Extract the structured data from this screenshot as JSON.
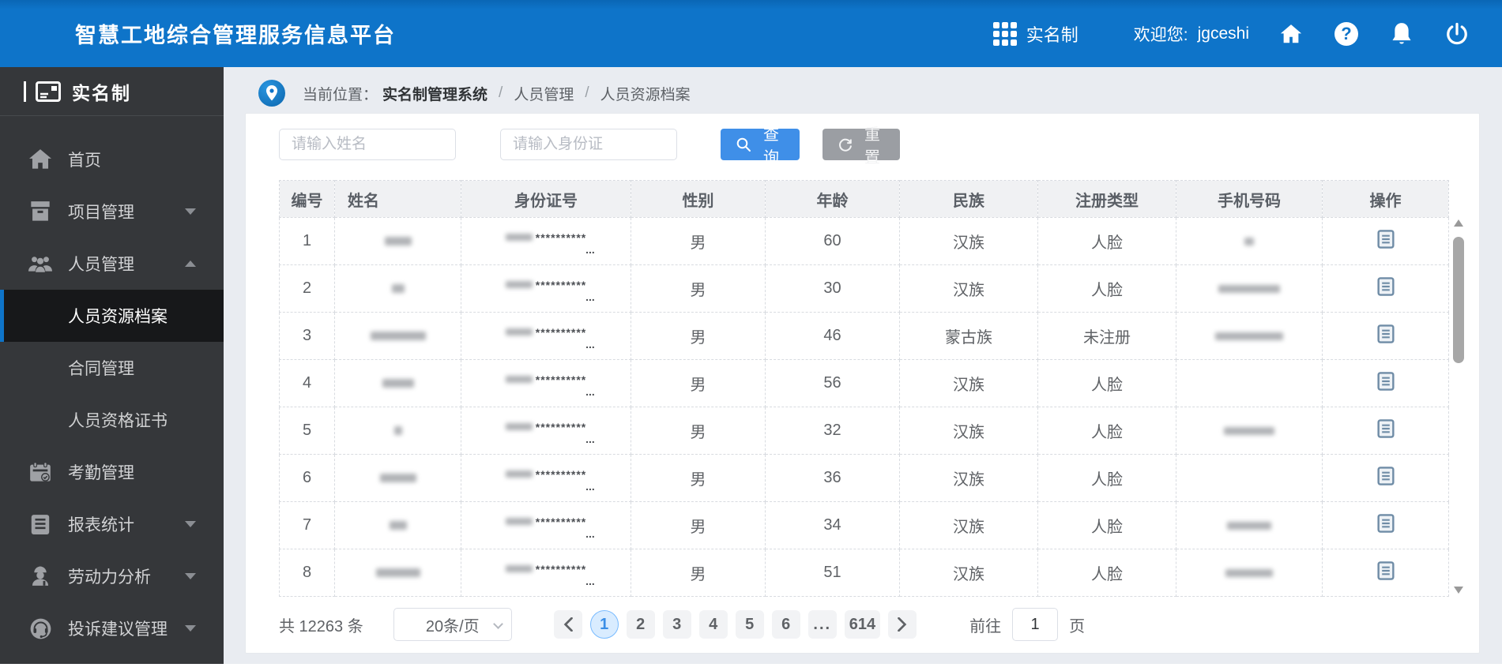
{
  "app": {
    "title": "智慧工地综合管理服务信息平台"
  },
  "topbar": {
    "module_label": "实名制",
    "welcome_label": "欢迎您:",
    "username": "jgceshi",
    "icons": [
      "apps-grid-icon",
      "home-icon",
      "help-icon",
      "bell-icon",
      "power-icon"
    ]
  },
  "sidebar": {
    "brand": "实名制",
    "items": [
      {
        "label": "首页",
        "icon": "home-icon"
      },
      {
        "label": "项目管理",
        "icon": "project-icon",
        "arrow": "down"
      },
      {
        "label": "人员管理",
        "icon": "people-icon",
        "arrow": "up",
        "children": [
          {
            "label": "人员资源档案",
            "active": true
          },
          {
            "label": "合同管理"
          },
          {
            "label": "人员资格证书"
          }
        ]
      },
      {
        "label": "考勤管理",
        "icon": "calendar-check-icon"
      },
      {
        "label": "报表统计",
        "icon": "report-icon",
        "arrow": "down"
      },
      {
        "label": "劳动力分析",
        "icon": "worker-icon",
        "arrow": "down"
      },
      {
        "label": "投诉建议管理",
        "icon": "headset-icon",
        "arrow": "down"
      }
    ]
  },
  "breadcrumb": {
    "prefix": "当前位置：",
    "root": "实名制管理系统",
    "sep": "/",
    "level1": "人员管理",
    "level2": "人员资源档案"
  },
  "filters": {
    "name_placeholder": "请输入姓名",
    "idcard_placeholder": "请输入身份证",
    "search_label": "查询",
    "reset_label": "重置"
  },
  "table": {
    "columns": [
      "编号",
      "姓名",
      "身份证号",
      "性别",
      "年龄",
      "民族",
      "注册类型",
      "手机号码",
      "操作"
    ],
    "id_mask": "**********",
    "id_overflow": "...",
    "rows": [
      {
        "no": "1",
        "gender": "男",
        "age": "60",
        "ethnic": "汉族",
        "reg_type": "人脸"
      },
      {
        "no": "2",
        "gender": "男",
        "age": "30",
        "ethnic": "汉族",
        "reg_type": "人脸"
      },
      {
        "no": "3",
        "gender": "男",
        "age": "46",
        "ethnic": "蒙古族",
        "reg_type": "未注册"
      },
      {
        "no": "4",
        "gender": "男",
        "age": "56",
        "ethnic": "汉族",
        "reg_type": "人脸"
      },
      {
        "no": "5",
        "gender": "男",
        "age": "32",
        "ethnic": "汉族",
        "reg_type": "人脸"
      },
      {
        "no": "6",
        "gender": "男",
        "age": "36",
        "ethnic": "汉族",
        "reg_type": "人脸"
      },
      {
        "no": "7",
        "gender": "男",
        "age": "34",
        "ethnic": "汉族",
        "reg_type": "人脸"
      },
      {
        "no": "8",
        "gender": "男",
        "age": "51",
        "ethnic": "汉族",
        "reg_type": "人脸"
      }
    ]
  },
  "pagination": {
    "total": "共 12263 条",
    "page_size": "20条/页",
    "pages": [
      "1",
      "2",
      "3",
      "4",
      "5",
      "6",
      "...",
      "614"
    ],
    "active": "1",
    "goto_label": "前往",
    "goto_value": "1",
    "goto_unit": "页"
  },
  "colors": {
    "topbar_blue": "#0e74c9",
    "sidebar_dark": "#35373a",
    "active_item_dark": "#17181a",
    "query_button_blue": "#3f8fe8",
    "reset_button_gray": "#9b9ea3",
    "active_page_bg": "#d9ecff",
    "active_page_border": "#79bbff",
    "active_page_text": "#3a8ee6"
  }
}
